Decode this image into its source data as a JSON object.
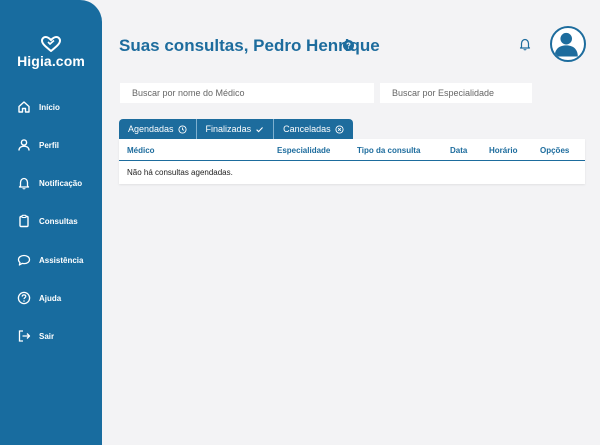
{
  "sidebar": {
    "logo_text": "Higia.com",
    "items": [
      {
        "label": "Início",
        "icon": "home-icon"
      },
      {
        "label": "Perfil",
        "icon": "user-icon"
      },
      {
        "label": "Notificação",
        "icon": "bell-icon"
      },
      {
        "label": "Consultas",
        "icon": "clipboard-icon"
      },
      {
        "label": "Assistência",
        "icon": "chat-icon"
      },
      {
        "label": "Ajuda",
        "icon": "help-icon"
      },
      {
        "label": "Sair",
        "icon": "logout-icon"
      }
    ]
  },
  "header": {
    "title": "Suas consultas, Pedro Henrique"
  },
  "search": {
    "doctor_placeholder": "Buscar por nome do Médico",
    "specialty_placeholder": "Buscar por Especialidade"
  },
  "tabs": [
    {
      "label": "Agendadas",
      "icon": "clock-icon"
    },
    {
      "label": "Finalizadas",
      "icon": "check-icon"
    },
    {
      "label": "Canceladas",
      "icon": "x-circle-icon"
    }
  ],
  "table": {
    "columns": [
      "Médico",
      "Especialidade",
      "Tipo da consulta",
      "Data",
      "Horário",
      "Opções"
    ],
    "empty_message": "Não há consultas agendadas."
  },
  "colors": {
    "sidebar": "#186c9f",
    "accent": "#1d6c9d",
    "background": "#f3f3f5"
  }
}
